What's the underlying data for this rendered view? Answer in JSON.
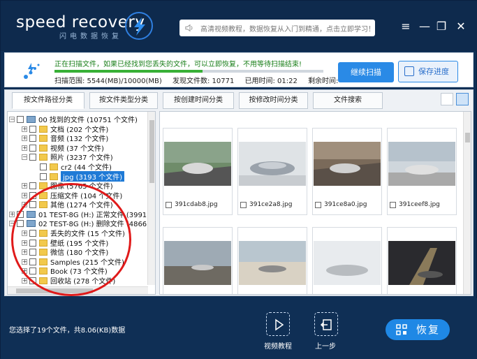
{
  "app": {
    "brand": "speed recovery",
    "brand_sub": "闪电数据恢复",
    "search_placeholder": "高清视频教程，数据恢复从入门到精通，点击立即学习！"
  },
  "scan": {
    "status": "正在扫描文件，如果已经找到您丢失的文件，可以立即恢复，不用等待扫描结束!",
    "progress_fraction": 0.55,
    "range": "扫描范围: 5544(MB)/10000(MB)",
    "found": "发现文件数: 10771",
    "elapsed": "已用时间: 01:22",
    "remaining": "剩余时间:",
    "continue_label": "继续扫描",
    "save_label": "保存进度"
  },
  "tabs": [
    "按文件路径分类",
    "按文件类型分类",
    "按创建时间分类",
    "按修改时间分类",
    "文件搜索"
  ],
  "tree": {
    "root": "00 找到的文件  (10751 个文件)",
    "root_items": [
      "文档    (202 个文件)",
      "音频    (132 个文件)",
      "视频    (37 个文件)",
      "照片    (3237 个文件)"
    ],
    "photo_children": [
      "cr2    (44 个文件)",
      "jpg    (3193 个文件)"
    ],
    "root_items_after": [
      "图像    (5765 个文件)",
      "压缩文件    (104 个文件)",
      "其他    (1274 个文件)"
    ],
    "drive1": "01 TEST-8G (H:) 正常文件 (3991 个",
    "drive2": "02 TEST-8G (H:) 删除文件 (4866 个",
    "drive2_items": [
      "丢失的文件    (15 个文件)",
      "壁纸    (195 个文件)",
      "微信    (180 个文件)",
      "Samples    (215 个文件)",
      "Book    (73 个文件)",
      "回收站    (278 个文件)"
    ]
  },
  "thumbs": [
    {
      "name": "391cdab8.jpg"
    },
    {
      "name": "391ce2a8.jpg"
    },
    {
      "name": "391ce8a0.jpg"
    },
    {
      "name": "391ceef8.jpg"
    }
  ],
  "footer": {
    "selection": "您选择了19个文件，共8.06(KB)数据",
    "video_tutorial": "视频教程",
    "back": "上一步",
    "recover": "恢复"
  }
}
